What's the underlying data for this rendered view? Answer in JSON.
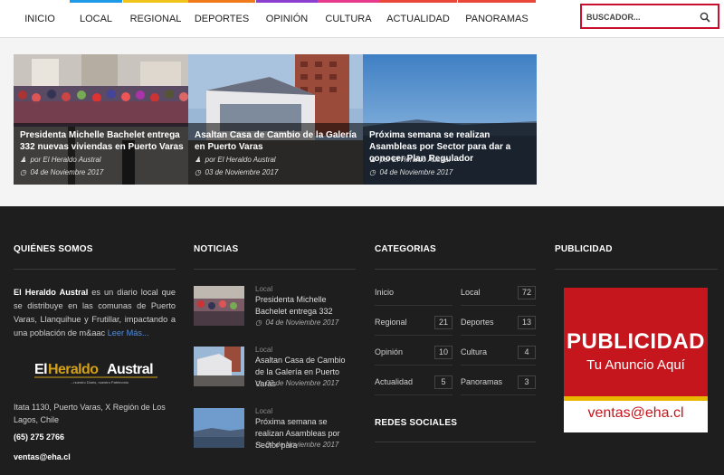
{
  "nav": {
    "items": [
      {
        "label": "INICIO",
        "color": "#ffffff"
      },
      {
        "label": "LOCAL",
        "color": "#1e9ae8"
      },
      {
        "label": "REGIONAL",
        "color": "#f0c419"
      },
      {
        "label": "DEPORTES",
        "color": "#f07a1a"
      },
      {
        "label": "OPINIÓN",
        "color": "#8a3fd1"
      },
      {
        "label": "CULTURA",
        "color": "#e83a8c"
      },
      {
        "label": "ACTUALIDAD",
        "color": "#e8473a"
      },
      {
        "label": "PANORAMAS",
        "color": "#e8473a"
      }
    ],
    "search_placeholder": "BUSCADOR..."
  },
  "slider": [
    {
      "title": "Presidenta Michelle Bachelet entrega 332 nuevas viviendas en Puerto Varas",
      "author": "por El Heraldo Austral",
      "date": "04 de Noviembre 2017"
    },
    {
      "title": "Asaltan Casa de Cambio de la Galería en Puerto Varas",
      "author": "por El Heraldo Austral",
      "date": "03 de Noviembre 2017"
    },
    {
      "title": "Próxima semana se realizan Asambleas por Sector para dar a conocer Plan Regulador",
      "author": "por El Heraldo Austral",
      "date": "04 de Noviembre 2017"
    }
  ],
  "footer": {
    "about_title": "QUIÉNES SOMOS",
    "about_name": "El Heraldo Austral",
    "about_text": " es un diario local que se distribuye en las comunas de Puerto Varas, Llanquihue y Frutillar, impactando a una población de m&aac ",
    "about_more": "Leer Más...",
    "logo_text": "ElHeraldoAustral",
    "logo_tagline": "...nuestro Diario, nuestro Patrimonio",
    "address": "Itata 1130, Puerto Varas, X Región de Los Lagos, Chile",
    "phone": "(65) 275 2766",
    "email": "ventas@eha.cl",
    "news_title": "NOTICIAS",
    "news": [
      {
        "category": "Local",
        "title": "Presidenta Michelle Bachelet entrega 332",
        "date": "04 de Noviembre 2017"
      },
      {
        "category": "Local",
        "title": "Asaltan Casa de Cambio de la Galería en Puerto Varas",
        "date": "03 de Noviembre 2017"
      },
      {
        "category": "Local",
        "title": "Próxima semana se realizan Asambleas por Sector para",
        "date": "04 de Noviembre 2017"
      }
    ],
    "categories_title": "CATEGORIAS",
    "categories": [
      {
        "name": "Inicio",
        "count": ""
      },
      {
        "name": "Local",
        "count": "72"
      },
      {
        "name": "Regional",
        "count": "21"
      },
      {
        "name": "Deportes",
        "count": "13"
      },
      {
        "name": "Opinión",
        "count": "10"
      },
      {
        "name": "Cultura",
        "count": "4"
      },
      {
        "name": "Actualidad",
        "count": "5"
      },
      {
        "name": "Panoramas",
        "count": "3"
      }
    ],
    "social_title": "REDES SOCIALES",
    "ad_title": "PUBLICIDAD",
    "ad_big": "PUBLICIDAD",
    "ad_sub": "Tu Anuncio Aquí",
    "ad_email": "ventas@eha.cl"
  }
}
